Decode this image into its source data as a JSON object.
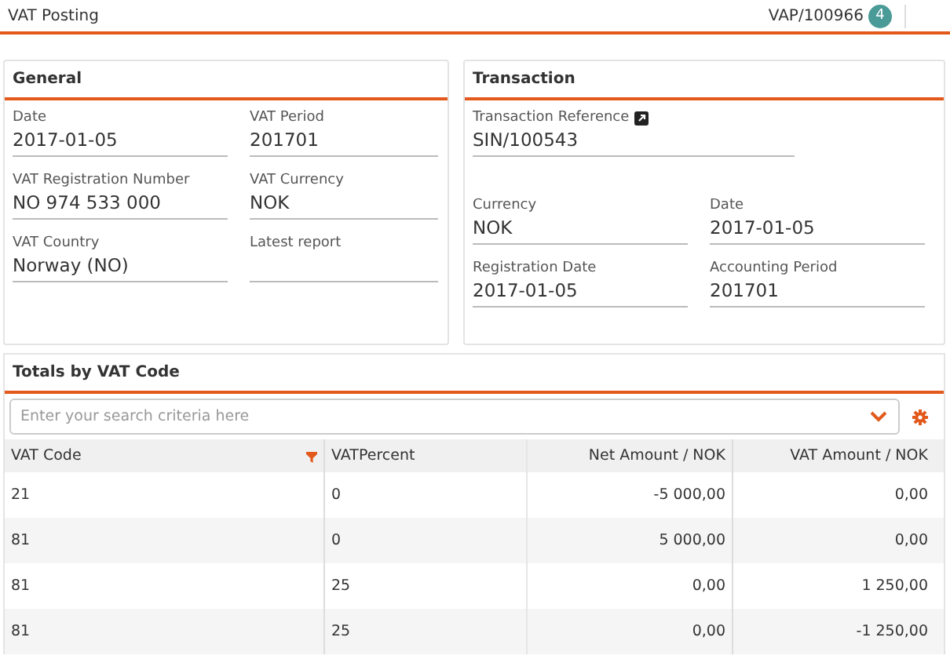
{
  "header": {
    "title": "VAT Posting",
    "reference": "VAP/100966",
    "badge": "4"
  },
  "general": {
    "title": "General",
    "fields": [
      {
        "label": "Date",
        "value": "2017-01-05"
      },
      {
        "label": "VAT Period",
        "value": "201701"
      },
      {
        "label": "VAT Registration Number",
        "value": "NO 974 533 000"
      },
      {
        "label": "VAT Currency",
        "value": "NOK"
      },
      {
        "label": "VAT Country",
        "value": "Norway (NO)"
      },
      {
        "label": "Latest report"
      }
    ]
  },
  "transaction": {
    "title": "Transaction",
    "reference": {
      "label": "Transaction Reference",
      "value": "SIN/100543"
    },
    "fields": [
      {
        "label": "Currency",
        "value": "NOK"
      },
      {
        "label": "Date",
        "value": "2017-01-05"
      },
      {
        "label": "Registration Date",
        "value": "2017-01-05"
      },
      {
        "label": "Accounting Period",
        "value": "201701"
      }
    ]
  },
  "totals": {
    "title": "Totals by VAT Code",
    "search": {
      "placeholder": "Enter your search criteria here"
    },
    "columns": [
      "VAT Code",
      "VATPercent",
      "Net Amount / NOK",
      "VAT Amount / NOK"
    ],
    "rows": [
      [
        "21",
        "0",
        "-5 000,00",
        "0,00"
      ],
      [
        "81",
        "0",
        "5 000,00",
        "0,00"
      ],
      [
        "81",
        "25",
        "0,00",
        "1 250,00"
      ],
      [
        "81",
        "25",
        "0,00",
        "-1 250,00"
      ]
    ]
  }
}
